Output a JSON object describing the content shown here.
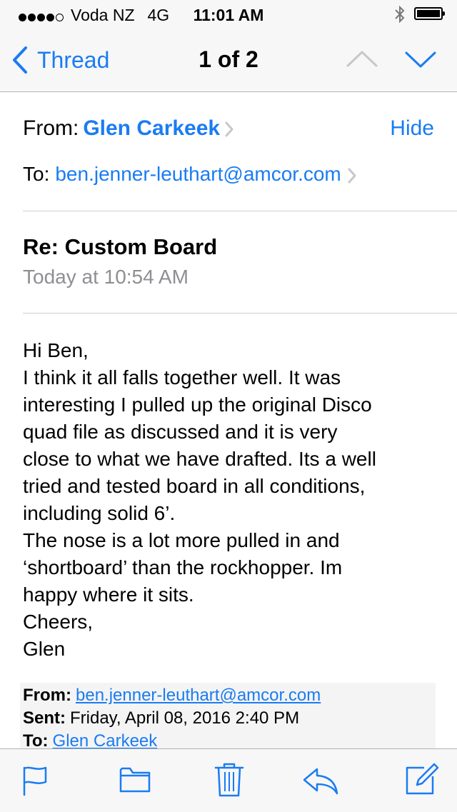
{
  "status_bar": {
    "carrier": "Voda NZ",
    "network": "4G",
    "time": "11:01 AM"
  },
  "nav": {
    "back_label": "Thread",
    "title": "1 of 2"
  },
  "header": {
    "from_label": "From:",
    "sender": "Glen Carkeek",
    "hide_label": "Hide",
    "to_label": "To:",
    "recipient": "ben.jenner-leuthart@amcor.com"
  },
  "message": {
    "subject": "Re: Custom Board",
    "date": "Today at 10:54 AM",
    "body_lines": [
      "Hi Ben,",
      "I think it all falls together well. It was",
      "interesting I pulled up the original Disco",
      "quad file as discussed and it is very",
      "close to what we have drafted. Its a well",
      "tried and tested board in all conditions,",
      "including solid 6’.",
      "The nose is a lot more pulled in and",
      "‘shortboard’ than the rockhopper. Im",
      "happy where it sits.",
      "Cheers,",
      "Glen"
    ]
  },
  "quoted": {
    "from_label": "From:",
    "from_value": "ben.jenner-leuthart@amcor.com",
    "sent_label": "Sent:",
    "sent_value": "Friday, April 08, 2016 2:40 PM",
    "to_label": "To:",
    "to_value": "Glen Carkeek"
  },
  "toolbar": {
    "icons": [
      "flag-icon",
      "folder-icon",
      "trash-icon",
      "reply-icon",
      "compose-icon"
    ]
  },
  "colors": {
    "accent": "#1a7cf2",
    "secondary_text": "#8e8e93",
    "bar_background": "#f7f7f7"
  }
}
